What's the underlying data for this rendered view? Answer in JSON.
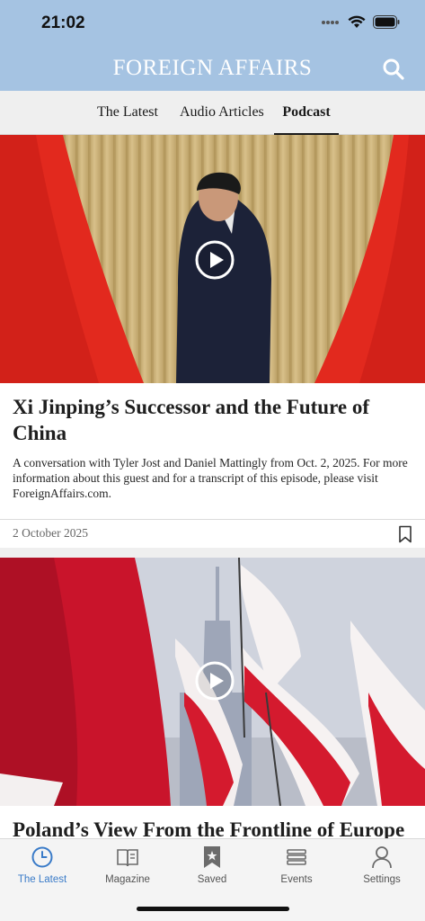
{
  "status_bar": {
    "time": "21:02"
  },
  "header": {
    "logo": "FOREIGN AFFAIRS"
  },
  "tabs": [
    {
      "label": "The Latest",
      "active": false
    },
    {
      "label": "Audio Articles",
      "active": false
    },
    {
      "label": "Podcast",
      "active": true
    }
  ],
  "episodes": [
    {
      "title": "Xi Jinping’s Successor and the Future of China",
      "description": "A conversation with Tyler Jost and Daniel Mattingly from Oct. 2, 2025. For more information about this guest and for a transcript of this episode, please visit ForeignAffairs.com.",
      "date": "2 October 2025"
    },
    {
      "title": "Poland’s View From the Frontline of Europe"
    }
  ],
  "tab_bar": [
    {
      "label": "The Latest",
      "icon": "clock-icon",
      "active": true
    },
    {
      "label": "Magazine",
      "icon": "magazine-icon",
      "active": false
    },
    {
      "label": "Saved",
      "icon": "bookmark-icon",
      "active": false
    },
    {
      "label": "Events",
      "icon": "events-icon",
      "active": false
    },
    {
      "label": "Settings",
      "icon": "person-icon",
      "active": false
    }
  ],
  "colors": {
    "header": "#a5c3e2",
    "accent": "#3a7bc8",
    "tab_bar": "#f4f4f4"
  }
}
